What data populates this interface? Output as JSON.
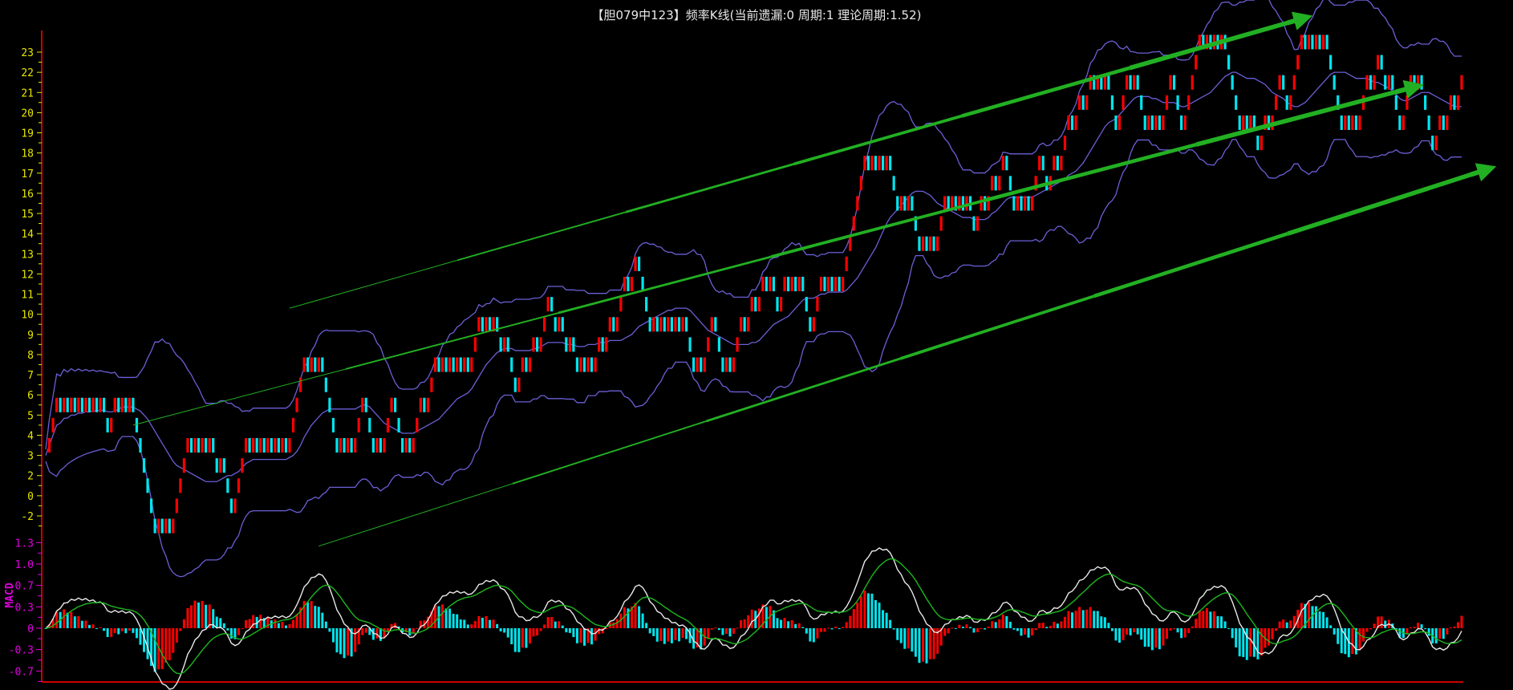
{
  "title": "【胆079中123】频率K线(当前遗漏:0 周期:1 理论周期:1.52)",
  "chart_data": {
    "type": "candlestick",
    "title": "【胆079中123】频率K线(当前遗漏:0 周期:1 理论周期:1.52)",
    "bar_count": 390,
    "note_pivots": "close price turning points as [bar_index, value]; candles move one unit per bar between pivots",
    "pivots": [
      [
        0,
        3
      ],
      [
        13,
        5
      ],
      [
        17,
        4
      ],
      [
        23,
        5
      ],
      [
        34,
        0
      ],
      [
        46,
        4
      ],
      [
        51,
        0
      ],
      [
        64,
        4
      ],
      [
        67,
        3
      ],
      [
        75,
        7
      ],
      [
        82,
        4
      ],
      [
        87,
        6
      ],
      [
        93,
        3
      ],
      [
        96,
        5
      ],
      [
        100,
        4
      ],
      [
        105,
        5
      ],
      [
        117,
        7
      ],
      [
        123,
        9
      ],
      [
        128,
        7
      ],
      [
        138,
        11
      ],
      [
        148,
        7
      ],
      [
        164,
        11
      ],
      [
        173,
        9
      ],
      [
        176,
        10
      ],
      [
        180,
        8
      ],
      [
        184,
        9
      ],
      [
        189,
        7
      ],
      [
        207,
        12
      ],
      [
        210,
        10
      ],
      [
        218,
        12
      ],
      [
        231,
        17
      ],
      [
        237,
        15
      ],
      [
        245,
        13
      ],
      [
        254,
        16
      ],
      [
        263,
        18
      ],
      [
        268,
        16
      ],
      [
        274,
        17
      ],
      [
        275,
        16
      ],
      [
        279,
        17
      ],
      [
        291,
        22
      ],
      [
        294,
        20
      ],
      [
        299,
        21
      ],
      [
        304,
        20
      ],
      [
        308,
        21
      ],
      [
        313,
        20
      ],
      [
        323,
        23
      ],
      [
        327,
        20
      ],
      [
        332,
        20
      ],
      [
        339,
        22
      ],
      [
        341,
        20
      ],
      [
        351,
        23
      ],
      [
        353,
        21
      ],
      [
        359,
        19
      ],
      [
        368,
        21
      ],
      [
        372,
        19
      ],
      [
        377,
        21
      ],
      [
        380,
        20
      ],
      [
        389,
        22
      ]
    ],
    "y_axis": {
      "tick_labels": [
        "23",
        "22",
        "21",
        "20",
        "19",
        "18",
        "17",
        "16",
        "15",
        "14",
        "13",
        "12",
        "11",
        "10",
        "9",
        "8",
        "7",
        "6",
        "5",
        "4",
        "3",
        "2",
        "0",
        "-2"
      ],
      "range": [
        -1,
        24
      ]
    },
    "bollinger": {
      "period": 20,
      "k": 2,
      "color": "#6b5fd6"
    },
    "macd": {
      "label": "MACD",
      "fast": 12,
      "slow": 26,
      "signal": 9,
      "tick_labels": [
        "1.3",
        "1.0",
        "0.7",
        "0.3",
        "0",
        "-0.3",
        "-0.7"
      ],
      "tick_values": [
        1.333,
        1.0,
        0.667,
        0.333,
        0,
        -0.333,
        -0.667
      ],
      "range": [
        -0.8,
        1.4
      ],
      "dif_color": "#e8e8e8",
      "dea_color": "#1db81d"
    },
    "trendlines": [
      {
        "from": [
          67,
          10.3
        ],
        "to": [
          344,
          24.6
        ]
      },
      {
        "from": [
          24,
          4.5
        ],
        "to": [
          374.5,
          21.2
        ]
      },
      {
        "from": [
          75,
          -1.5
        ],
        "to": [
          394.5,
          17.1
        ]
      }
    ],
    "colors": {
      "up": "#ff0000",
      "down": "#00e5ee",
      "axis": "#cc0000",
      "trend": "#22b022"
    }
  }
}
